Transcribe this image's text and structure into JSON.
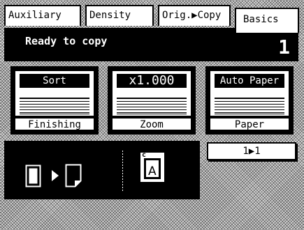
{
  "tabs": [
    {
      "label": "Auxiliary"
    },
    {
      "label": "Density"
    },
    {
      "label": "Orig.▶Copy"
    },
    {
      "label": "Basics",
      "active": true
    }
  ],
  "status": {
    "message": "Ready to copy",
    "count": "1"
  },
  "keys": [
    {
      "value": "Sort",
      "label": "Finishing"
    },
    {
      "value": "x1.000",
      "label": "Zoom"
    },
    {
      "value": "Auto Paper",
      "label": "Paper"
    }
  ],
  "duplex": {
    "original_corner": "c",
    "original_letter": "A"
  },
  "mode_button": {
    "label": "1▶1"
  },
  "colors": {
    "ink": "#000000",
    "paper": "#ffffff"
  }
}
